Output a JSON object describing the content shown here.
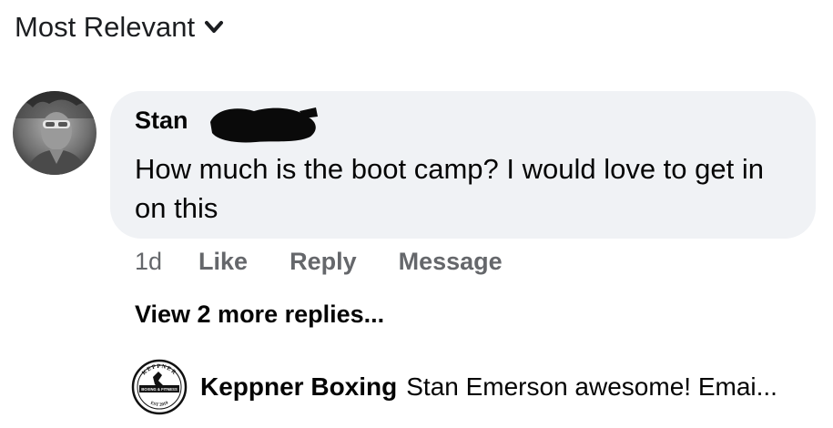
{
  "sort": {
    "label": "Most Relevant",
    "icon": "chevron-down-icon"
  },
  "comment": {
    "author": "Stan",
    "text": "How much is the boot camp? I would love to get in on this",
    "timestamp": "1d",
    "actions": {
      "like": "Like",
      "reply": "Reply",
      "message": "Message"
    },
    "more_replies": "View 2 more replies..."
  },
  "reply_preview": {
    "author": "Keppner Boxing",
    "text": "Stan Emerson awesome!  Emai...",
    "logo_text": {
      "top": "KEPPNER",
      "middle": "BOXING & FITNESS",
      "bottom": "EST 2019"
    }
  },
  "colors": {
    "bubble": "#f0f2f5",
    "text_primary": "#050505",
    "text_secondary": "#65676b"
  }
}
